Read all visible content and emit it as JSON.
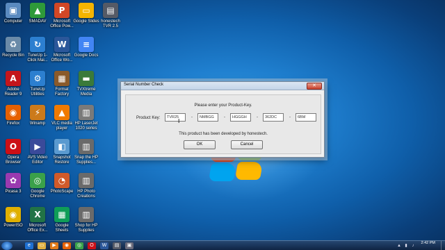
{
  "desktop": {
    "icons": [
      {
        "label": "Computer",
        "icon": "computer-icon",
        "glyph": "▣",
        "color": "#5a8ac0"
      },
      {
        "label": "SMADAV",
        "icon": "smadav-icon",
        "glyph": "▲",
        "color": "#2e9a3a"
      },
      {
        "label": "Microsoft Office Pow...",
        "icon": "powerpoint-icon",
        "glyph": "P",
        "color": "#d24726"
      },
      {
        "label": "Google Slides",
        "icon": "google-slides-icon",
        "glyph": "▭",
        "color": "#f4b400"
      },
      {
        "label": "honestech TVR 2.5",
        "icon": "honestech-icon",
        "glyph": "▤",
        "color": "#555a66"
      },
      {
        "label": "Recycle Bin",
        "icon": "recycle-bin-icon",
        "glyph": "♻",
        "color": "#6a8aa8"
      },
      {
        "label": "TuneUp 1-Click Mai...",
        "icon": "tuneup-1click-icon",
        "glyph": "↻",
        "color": "#2c7fd0"
      },
      {
        "label": "Microsoft Office Wo...",
        "icon": "word-icon",
        "glyph": "W",
        "color": "#2b579a"
      },
      {
        "label": "Google Docs",
        "icon": "google-docs-icon",
        "glyph": "≡",
        "color": "#4285f4"
      },
      {
        "label": "Adobe Reader 9",
        "icon": "adobe-reader-icon",
        "glyph": "A",
        "color": "#c4161c"
      },
      {
        "label": "TuneUp Utilities",
        "icon": "tuneup-utilities-icon",
        "glyph": "⚙",
        "color": "#2c7fd0"
      },
      {
        "label": "Format Factory",
        "icon": "format-factory-icon",
        "glyph": "▦",
        "color": "#8a5a2a"
      },
      {
        "label": "TVXtreme Media",
        "icon": "tvxtreme-icon",
        "glyph": "▬",
        "color": "#3a7a3a"
      },
      {
        "label": "Firefox",
        "icon": "firefox-icon",
        "glyph": "◉",
        "color": "#e66000"
      },
      {
        "label": "Winamp",
        "icon": "winamp-icon",
        "glyph": "⚡",
        "color": "#cc7a1a"
      },
      {
        "label": "VLC media player",
        "icon": "vlc-icon",
        "glyph": "▲",
        "color": "#f07a00"
      },
      {
        "label": "HP LaserJet 1020 series",
        "icon": "printer-icon",
        "glyph": "▥",
        "color": "#7a7a7a"
      },
      {
        "label": "Opera Browser",
        "icon": "opera-icon",
        "glyph": "O",
        "color": "#cc0f16"
      },
      {
        "label": "AVS Video Editor",
        "icon": "avs-video-icon",
        "glyph": "▶",
        "color": "#3a4a9a"
      },
      {
        "label": "Snapshot Restore",
        "icon": "snapshot-icon",
        "glyph": "◧",
        "color": "#5a9ad0"
      },
      {
        "label": "Snap the HP Supplies...",
        "icon": "hp-supplies-icon",
        "glyph": "▥",
        "color": "#6a6a6a"
      },
      {
        "label": "Picasa 3",
        "icon": "picasa-icon",
        "glyph": "✿",
        "color": "#9a3ab0"
      },
      {
        "label": "Google Chrome",
        "icon": "chrome-icon",
        "glyph": "◎",
        "color": "#3aa14a"
      },
      {
        "label": "PhotoScape",
        "icon": "photoscape-icon",
        "glyph": "◔",
        "color": "#d05a2a"
      },
      {
        "label": "HP Photo Creations",
        "icon": "hp-photo-icon",
        "glyph": "▥",
        "color": "#6a6a6a"
      },
      {
        "label": "PowerISO",
        "icon": "poweriso-icon",
        "glyph": "◉",
        "color": "#e0b000"
      },
      {
        "label": "Microsoft Office Ex...",
        "icon": "excel-icon",
        "glyph": "X",
        "color": "#217346"
      },
      {
        "label": "Google Sheets",
        "icon": "google-sheets-icon",
        "glyph": "▦",
        "color": "#0f9d58"
      },
      {
        "label": "Shop for HP Supplies",
        "icon": "shop-hp-icon",
        "glyph": "▥",
        "color": "#6a6a6a"
      }
    ]
  },
  "dialog": {
    "title": "Serial Number Check",
    "close_glyph": "✕",
    "prompt": "Please enter your Product-Key.",
    "product_key_label": "Product Key:",
    "separator": "-",
    "key_parts": [
      "TVR25",
      "NMBGG",
      "HGGGH",
      "362DC",
      "6BM"
    ],
    "developer_note": "This product has been developed by honestech.",
    "ok_label": "OK",
    "cancel_label": "Cancel"
  },
  "taskbar": {
    "pinned": [
      {
        "icon": "ie-icon",
        "glyph": "e",
        "color": "#1e6fd0"
      },
      {
        "icon": "explorer-icon",
        "glyph": "▭",
        "color": "#e0b040"
      },
      {
        "icon": "media-player-icon",
        "glyph": "▶",
        "color": "#e07a1a"
      },
      {
        "icon": "firefox-icon",
        "glyph": "◉",
        "color": "#e66000"
      },
      {
        "icon": "chrome-icon",
        "glyph": "◎",
        "color": "#3aa14a"
      },
      {
        "icon": "opera-icon",
        "glyph": "O",
        "color": "#cc0f16"
      },
      {
        "icon": "word-icon",
        "glyph": "W",
        "color": "#2b579a"
      },
      {
        "icon": "honestech-icon",
        "glyph": "▤",
        "color": "#555a66"
      },
      {
        "icon": "app-icon",
        "glyph": "▣",
        "color": "#6a6a7a"
      }
    ],
    "clock_time": "2:42 PM"
  }
}
